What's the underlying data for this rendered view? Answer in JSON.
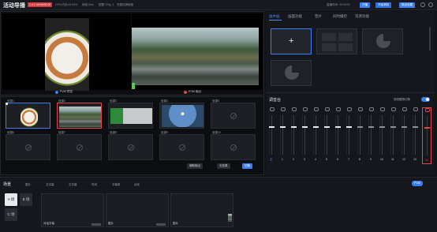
{
  "app": {
    "title": "活动导播",
    "live_badge": "1.4.1 00:00:00:00",
    "cpu": "CPU:内存:23.00%",
    "network": "网络:0ms",
    "scene": "配置:720p_1",
    "quality": "完善的清晰度"
  },
  "header_right": {
    "time_label": "直播时间: 00:00:00",
    "btn_start": "开播",
    "btn_record": "开始录制",
    "btn_output": "输出设置"
  },
  "preview": {
    "pvw_label": "PVW 预览",
    "pgm_label": "PGM 输出"
  },
  "sources": [
    {
      "label": "信源1",
      "kind": "food"
    },
    {
      "label": "信源2",
      "kind": "river"
    },
    {
      "label": "信源3",
      "kind": "green"
    },
    {
      "label": "信源4",
      "kind": "sky"
    },
    {
      "label": "信源5",
      "kind": "empty"
    },
    {
      "label": "信源6",
      "kind": "empty"
    },
    {
      "label": "信源7",
      "kind": "empty"
    },
    {
      "label": "信源8",
      "kind": "empty"
    },
    {
      "label": "信源9",
      "kind": "empty"
    },
    {
      "label": "信源10",
      "kind": "empty"
    }
  ],
  "source_controls": {
    "audio_btn": "辅助输出",
    "cut_btn": "无效果",
    "fade_btn": "切换"
  },
  "right_tabs": [
    "画中画",
    "画面功能",
    "垫片",
    "同时播控",
    "资源功能"
  ],
  "mixer": {
    "title": "调音台",
    "sync_label": "音频跟随切换",
    "channels": [
      "主",
      "1",
      "2",
      "3",
      "4",
      "5",
      "6",
      "7",
      "8",
      "9",
      "10",
      "11",
      "12",
      "13",
      "14"
    ]
  },
  "scenes_panel": {
    "title": "场景",
    "actions": [
      "图片",
      "文字幕",
      "文字幕",
      "时间",
      "字幕条",
      "台标"
    ],
    "scene_buttons": [
      "A 场",
      "B 场",
      "C 场"
    ],
    "scenes": [
      "对话字幕",
      "图片",
      "图片"
    ],
    "pvw_btn": "PVW"
  },
  "colors": {
    "accent": "#3c7ff2",
    "pgm": "#e0474c",
    "live": "#d8363b",
    "pvw": "#3c7ff2"
  }
}
